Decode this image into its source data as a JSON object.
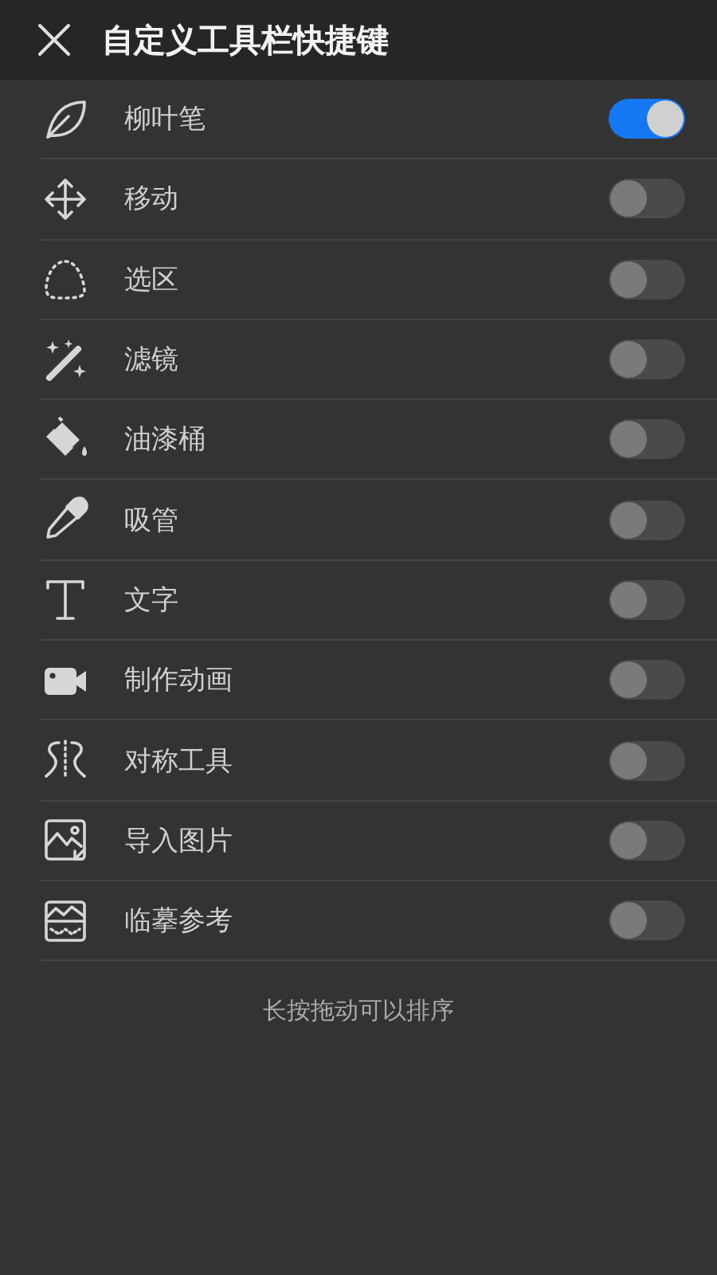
{
  "header": {
    "title": "自定义工具栏快捷键"
  },
  "tools": [
    {
      "label": "柳叶笔",
      "on": true
    },
    {
      "label": "移动",
      "on": false
    },
    {
      "label": "选区",
      "on": false
    },
    {
      "label": "滤镜",
      "on": false
    },
    {
      "label": "油漆桶",
      "on": false
    },
    {
      "label": "吸管",
      "on": false
    },
    {
      "label": "文字",
      "on": false
    },
    {
      "label": "制作动画",
      "on": false
    },
    {
      "label": "对称工具",
      "on": false
    },
    {
      "label": "导入图片",
      "on": false
    },
    {
      "label": "临摹参考",
      "on": false
    }
  ],
  "hint": "长按拖动可以排序"
}
